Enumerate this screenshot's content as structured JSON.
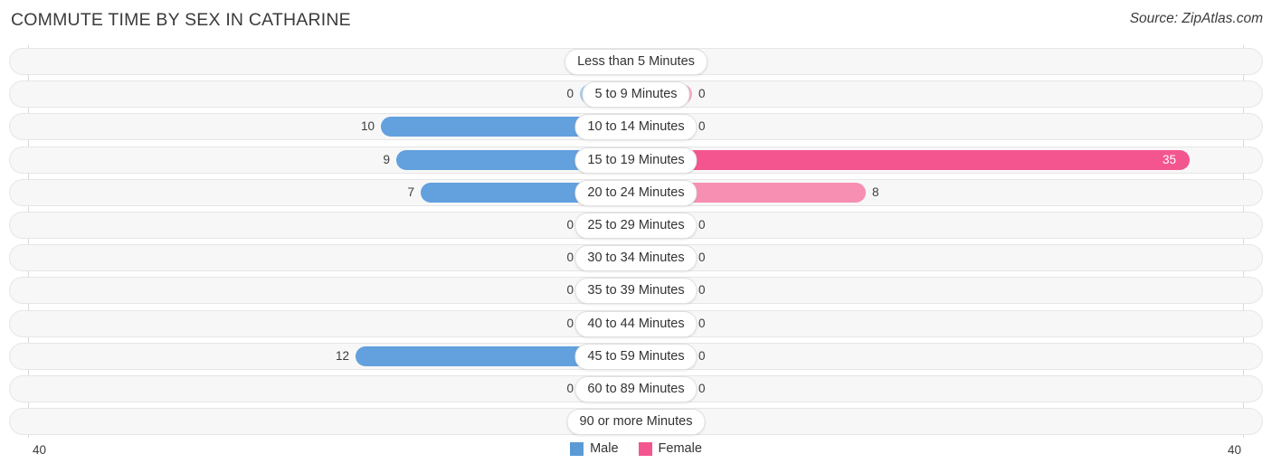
{
  "header": {
    "title": "COMMUTE TIME BY SEX IN CATHARINE",
    "source": "Source: ZipAtlas.com"
  },
  "legend": {
    "male_label": "Male",
    "female_label": "Female",
    "male_color": "#5B9BD5",
    "female_color": "#F4558F"
  },
  "axis": {
    "left_label": "40",
    "right_label": "40",
    "max": 40
  },
  "colors": {
    "male_zero": "#A8C8EC",
    "male_value": "#62A0DE",
    "female_zero": "#F7A8C4",
    "female_mid": "#F78FB3",
    "female_high": "#F4558F"
  },
  "chart_data": {
    "type": "bar",
    "title": "COMMUTE TIME BY SEX IN CATHARINE",
    "xlabel": "",
    "ylabel": "",
    "orientation": "horizontal-diverging",
    "xlim": [
      40,
      40
    ],
    "categories": [
      "Less than 5 Minutes",
      "5 to 9 Minutes",
      "10 to 14 Minutes",
      "15 to 19 Minutes",
      "20 to 24 Minutes",
      "25 to 29 Minutes",
      "30 to 34 Minutes",
      "35 to 39 Minutes",
      "40 to 44 Minutes",
      "45 to 59 Minutes",
      "60 to 89 Minutes",
      "90 or more Minutes"
    ],
    "series": [
      {
        "name": "Male",
        "values": [
          0,
          0,
          10,
          9,
          7,
          0,
          0,
          0,
          0,
          12,
          0,
          0
        ]
      },
      {
        "name": "Female",
        "values": [
          0,
          0,
          0,
          35,
          8,
          0,
          0,
          0,
          0,
          0,
          0,
          0
        ]
      }
    ],
    "legend_position": "bottom",
    "grid": false
  },
  "rows": [
    {
      "label": "Less than 5 Minutes",
      "male": "0",
      "female": "0",
      "male_w": 62,
      "female_w": 62,
      "male_color": "#A8C8EC",
      "female_color": "#F7A8C4",
      "female_inside": false
    },
    {
      "label": "5 to 9 Minutes",
      "male": "0",
      "female": "0",
      "male_w": 62,
      "female_w": 62,
      "male_color": "#A8C8EC",
      "female_color": "#F7A8C4",
      "female_inside": false
    },
    {
      "label": "10 to 14 Minutes",
      "male": "10",
      "female": "0",
      "male_w": 282,
      "female_w": 62,
      "male_color": "#62A0DE",
      "female_color": "#F7A8C4",
      "female_inside": false
    },
    {
      "label": "15 to 19 Minutes",
      "male": "9",
      "female": "35",
      "male_w": 265,
      "female_w": 612,
      "male_color": "#62A0DE",
      "female_color": "#F4558F",
      "female_inside": true
    },
    {
      "label": "20 to 24 Minutes",
      "male": "7",
      "female": "8",
      "male_w": 238,
      "female_w": 254,
      "male_color": "#62A0DE",
      "female_color": "#F78FB3",
      "female_inside": false
    },
    {
      "label": "25 to 29 Minutes",
      "male": "0",
      "female": "0",
      "male_w": 62,
      "female_w": 62,
      "male_color": "#A8C8EC",
      "female_color": "#F7A8C4",
      "female_inside": false
    },
    {
      "label": "30 to 34 Minutes",
      "male": "0",
      "female": "0",
      "male_w": 62,
      "female_w": 62,
      "male_color": "#A8C8EC",
      "female_color": "#F7A8C4",
      "female_inside": false
    },
    {
      "label": "35 to 39 Minutes",
      "male": "0",
      "female": "0",
      "male_w": 62,
      "female_w": 62,
      "male_color": "#A8C8EC",
      "female_color": "#F7A8C4",
      "female_inside": false
    },
    {
      "label": "40 to 44 Minutes",
      "male": "0",
      "female": "0",
      "male_w": 62,
      "female_w": 62,
      "male_color": "#A8C8EC",
      "female_color": "#F7A8C4",
      "female_inside": false
    },
    {
      "label": "45 to 59 Minutes",
      "male": "12",
      "female": "0",
      "male_w": 310,
      "female_w": 62,
      "male_color": "#62A0DE",
      "female_color": "#F7A8C4",
      "female_inside": false
    },
    {
      "label": "60 to 89 Minutes",
      "male": "0",
      "female": "0",
      "male_w": 62,
      "female_w": 62,
      "male_color": "#A8C8EC",
      "female_color": "#F7A8C4",
      "female_inside": false
    },
    {
      "label": "90 or more Minutes",
      "male": "0",
      "female": "0",
      "male_w": 62,
      "female_w": 62,
      "male_color": "#A8C8EC",
      "female_color": "#F7A8C4",
      "female_inside": false
    }
  ]
}
